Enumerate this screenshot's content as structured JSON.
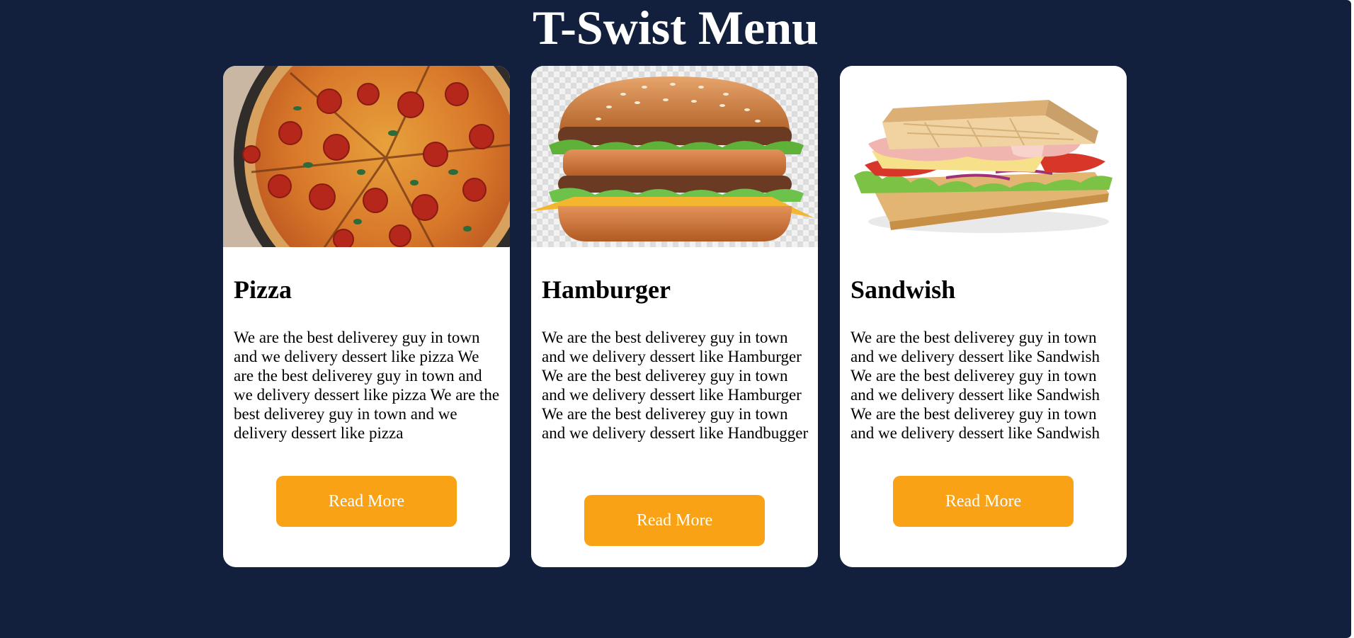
{
  "page": {
    "title": "T-Swist Menu"
  },
  "colors": {
    "background": "#13203d",
    "card": "#ffffff",
    "button": "#f9a215",
    "button_text": "#ffffff"
  },
  "cards": [
    {
      "image": "pizza-photo",
      "title": "Pizza",
      "description": "We are the best deliverey guy in town and we delivery dessert like pizza We are the best deliverey guy in town and we delivery dessert like pizza We are the best deliverey guy in town and we delivery dessert like pizza",
      "button_label": "Read More"
    },
    {
      "image": "hamburger-photo",
      "title": "Hamburger",
      "description": "We are the best deliverey guy in town and we delivery dessert like Hamburger We are the best deliverey guy in town and we delivery dessert like Hamburger We are the best deliverey guy in town and we delivery dessert like Handbugger",
      "button_label": "Read More"
    },
    {
      "image": "sandwich-photo",
      "title": "Sandwish",
      "description": "We are the best deliverey guy in town and we delivery dessert like Sandwish We are the best deliverey guy in town and we delivery dessert like Sandwish We are the best deliverey guy in town and we delivery dessert like Sandwish",
      "button_label": "Read More"
    }
  ]
}
